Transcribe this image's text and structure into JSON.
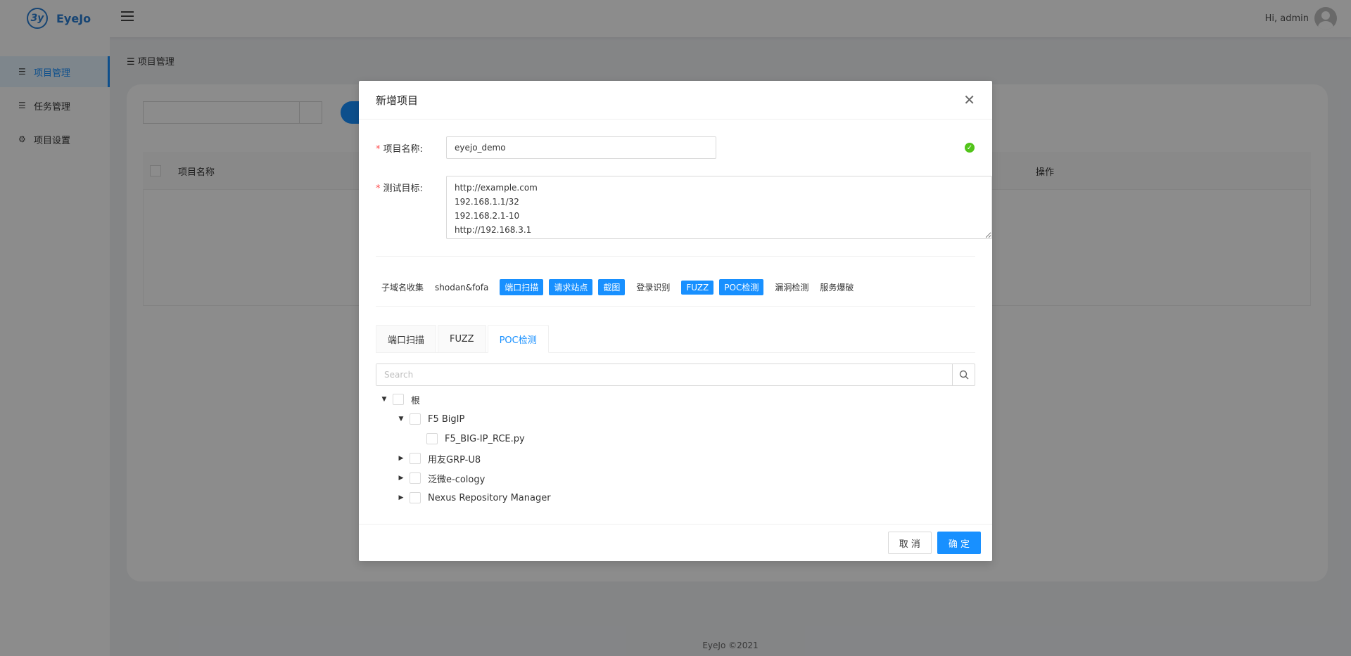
{
  "app": {
    "logo_mark": "3y",
    "logo_text": "EyeJo",
    "user_greeting": "Hi, admin"
  },
  "sidebar": {
    "items": [
      {
        "label": "项目管理",
        "icon": "list-icon"
      },
      {
        "label": "任务管理",
        "icon": "list-icon"
      },
      {
        "label": "项目设置",
        "icon": "gear-icon"
      }
    ]
  },
  "breadcrumb": "项目管理",
  "table": {
    "columns": [
      "项目名称",
      "操作"
    ]
  },
  "footer": "EyeJo ©2021",
  "modal": {
    "title": "新增项目",
    "name_label": "项目名称:",
    "name_value": "eyejo_demo",
    "target_label": "测试目标:",
    "targets": "http://example.com\n192.168.1.1/32\n192.168.2.1-10\nhttp://192.168.3.1",
    "tags": [
      {
        "label": "子域名收集",
        "selected": false
      },
      {
        "label": "shodan&fofa",
        "selected": false
      },
      {
        "label": "端口扫描",
        "selected": true
      },
      {
        "label": "请求站点",
        "selected": true
      },
      {
        "label": "截图",
        "selected": true
      },
      {
        "label": "登录识别",
        "selected": false
      },
      {
        "label": "FUZZ",
        "selected": true
      },
      {
        "label": "POC检测",
        "selected": true
      },
      {
        "label": "漏洞检测",
        "selected": false
      },
      {
        "label": "服务爆破",
        "selected": false
      }
    ],
    "tabs": [
      "端口扫描",
      "FUZZ",
      "POC检测"
    ],
    "active_tab": "POC检测",
    "search_placeholder": "Search",
    "tree": {
      "root": "根",
      "nodes": [
        {
          "label": "F5 BigIP",
          "expanded": true,
          "children": [
            "F5_BIG-IP_RCE.py"
          ]
        },
        {
          "label": "用友GRP-U8",
          "expanded": false
        },
        {
          "label": "泛微e-cology",
          "expanded": false
        },
        {
          "label": "Nexus Repository Manager",
          "expanded": false
        }
      ]
    },
    "cancel_label": "取 消",
    "confirm_label": "确 定"
  },
  "colors": {
    "primary": "#1890ff",
    "success": "#52c41a",
    "required": "#ff4d4f"
  }
}
